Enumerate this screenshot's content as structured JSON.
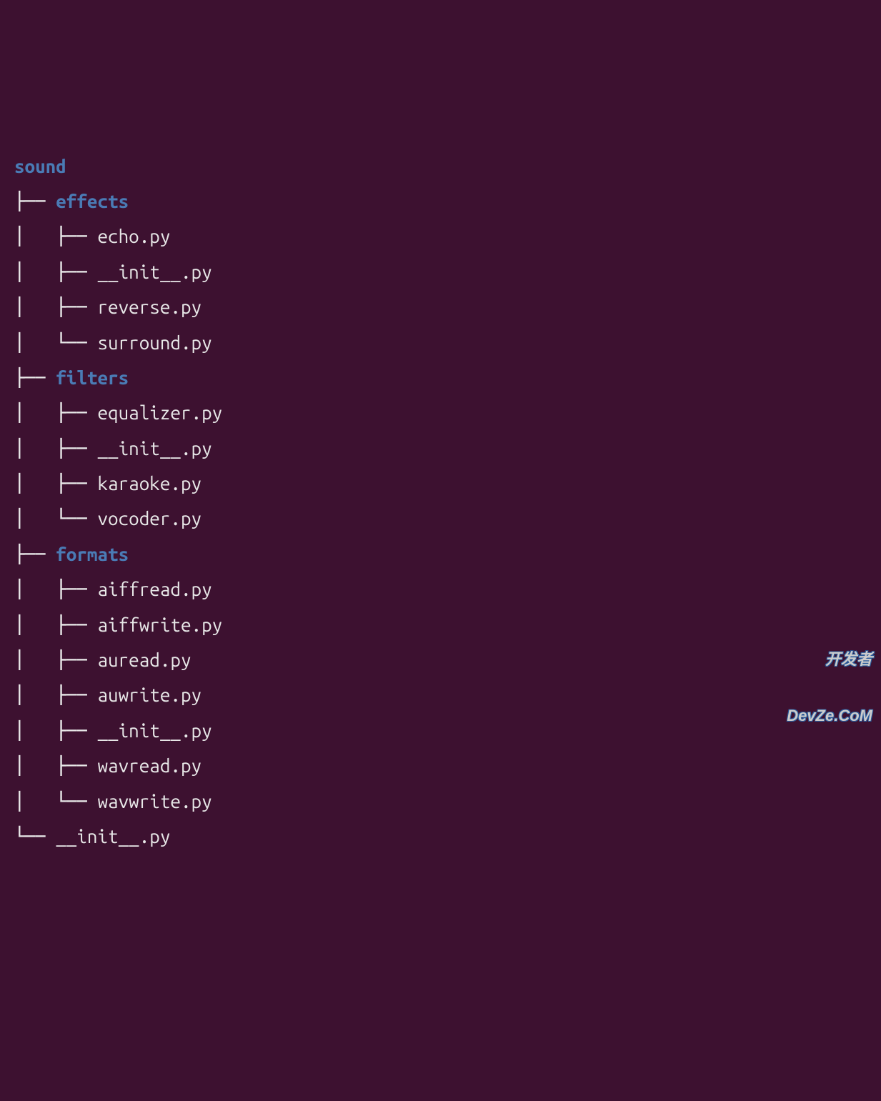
{
  "tree": {
    "root": "sound",
    "children": [
      {
        "name": "effects",
        "type": "dir",
        "children": [
          {
            "name": "echo.py",
            "type": "file"
          },
          {
            "name": "__init__.py",
            "type": "file"
          },
          {
            "name": "reverse.py",
            "type": "file"
          },
          {
            "name": "surround.py",
            "type": "file"
          }
        ]
      },
      {
        "name": "filters",
        "type": "dir",
        "children": [
          {
            "name": "equalizer.py",
            "type": "file"
          },
          {
            "name": "__init__.py",
            "type": "file"
          },
          {
            "name": "karaoke.py",
            "type": "file"
          },
          {
            "name": "vocoder.py",
            "type": "file"
          }
        ]
      },
      {
        "name": "formats",
        "type": "dir",
        "children": [
          {
            "name": "aiffread.py",
            "type": "file"
          },
          {
            "name": "aiffwrite.py",
            "type": "file"
          },
          {
            "name": "auread.py",
            "type": "file"
          },
          {
            "name": "auwrite.py",
            "type": "file"
          },
          {
            "name": "__init__.py",
            "type": "file"
          },
          {
            "name": "wavread.py",
            "type": "file"
          },
          {
            "name": "wavwrite.py",
            "type": "file"
          }
        ]
      },
      {
        "name": "__init__.py",
        "type": "file"
      }
    ]
  },
  "watermark": {
    "line1": "开发者",
    "line2": "DevZe.CoM"
  },
  "glyphs": {
    "tee": "├── ",
    "elbow": "└── ",
    "pipe": "│   ",
    "space": "    "
  }
}
